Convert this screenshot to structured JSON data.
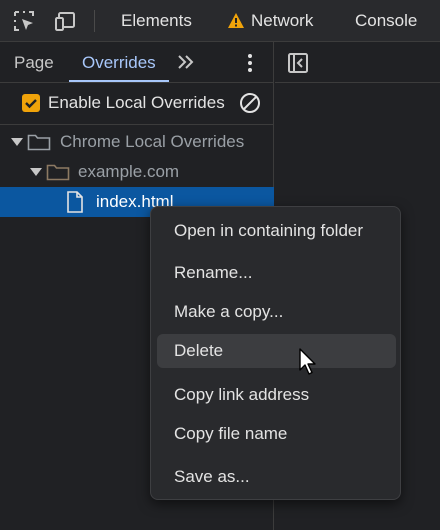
{
  "toolbar": {
    "tabs": [
      {
        "label": "Elements"
      },
      {
        "label": "Network",
        "has_warning": true
      },
      {
        "label": "Console"
      }
    ]
  },
  "sidebar": {
    "tabs": [
      {
        "label": "Page",
        "active": false
      },
      {
        "label": "Overrides",
        "active": true
      }
    ],
    "enable_overrides": {
      "label": "Enable Local Overrides",
      "checked": true
    },
    "tree": [
      {
        "label": "Chrome Local Overrides",
        "type": "folder",
        "expanded": true,
        "level": 0
      },
      {
        "label": "example.com",
        "type": "folder",
        "expanded": true,
        "level": 1
      },
      {
        "label": "index.html",
        "type": "file",
        "selected": true,
        "level": 2
      }
    ]
  },
  "context_menu": {
    "items": [
      {
        "label": "Open in containing folder"
      },
      {
        "label": "Rename..."
      },
      {
        "label": "Make a copy..."
      },
      {
        "label": "Delete",
        "hovered": true
      },
      {
        "label": "Copy link address"
      },
      {
        "label": "Copy file name"
      },
      {
        "label": "Save as..."
      }
    ]
  },
  "colors": {
    "background": "#202124",
    "accent": "#a8c7fa",
    "selection": "#0b57a0",
    "checkbox": "#f0a30a",
    "warning": "#f0a30a"
  }
}
